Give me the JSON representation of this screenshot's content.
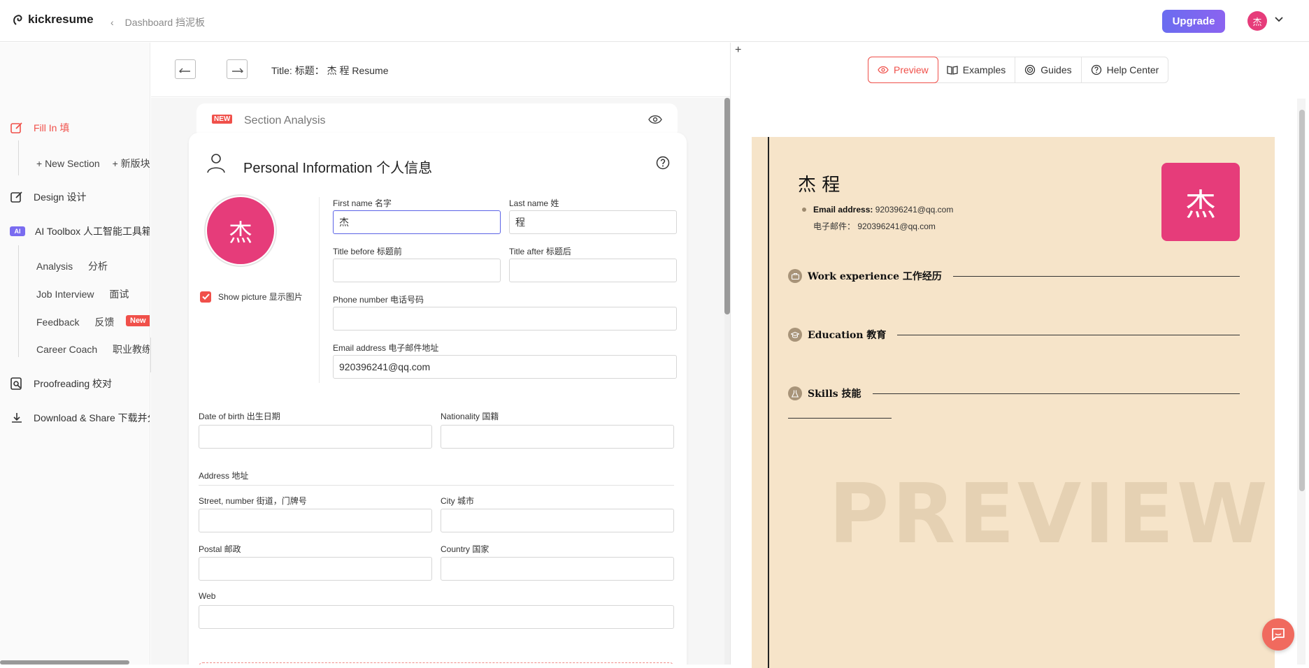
{
  "header": {
    "logo": "kickresume",
    "breadcrumb": "Dashboard 挡泥板",
    "upgrade_label": "Upgrade",
    "avatar_initial": "杰"
  },
  "sidebar": {
    "fill_in": "Fill In 填",
    "new_section": "+ New Section",
    "new_section_cn": "+ 新版块",
    "design": "Design 设计",
    "ai_badge": "AI",
    "ai_toolbox": "AI Toolbox 人工智能工具箱",
    "analysis": "Analysis",
    "analysis_cn": "分析",
    "job_interview": "Job Interview",
    "job_interview_cn": "面试",
    "feedback": "Feedback",
    "feedback_cn": "反馈",
    "feedback_badge": "New",
    "career_coach": "Career Coach",
    "career_coach_cn": "职业教练",
    "proofreading": "Proofreading 校对",
    "download": "Download & Share 下载并分享"
  },
  "toolbar": {
    "title": "Title: 标题：  杰 程 Resume"
  },
  "editor": {
    "analysis_badge": "NEW",
    "analysis_label": "Section Analysis",
    "card_title": "Personal Information 个人信息",
    "photo_initial": "杰",
    "show_picture": "Show picture 显示图片",
    "show_picture_checked": true,
    "fields": {
      "first_name_label": "First name 名字",
      "first_name_value": "杰",
      "last_name_label": "Last name 姓",
      "last_name_value": "程",
      "title_before_label": "Title before 标题前",
      "title_before_value": "",
      "title_after_label": "Title after 标题后",
      "title_after_value": "",
      "phone_label": "Phone number 电话号码",
      "phone_value": "",
      "email_label": "Email address 电子邮件地址",
      "email_value": "920396241@qq.com",
      "dob_label": "Date of birth 出生日期",
      "dob_value": "",
      "nationality_label": "Nationality 国籍",
      "nationality_value": "",
      "address_header": "Address 地址",
      "street_label": "Street, number 街道，门牌号",
      "street_value": "",
      "city_label": "City 城市",
      "city_value": "",
      "postal_label": "Postal 邮政",
      "postal_value": "",
      "country_label": "Country 国家",
      "country_value": "",
      "web_label": "Web",
      "web_value": ""
    }
  },
  "preview_panel": {
    "plus": "+",
    "tabs": [
      "Preview",
      "Examples",
      "Guides",
      "Help Center"
    ],
    "active_tab": "Preview",
    "resume": {
      "name": "杰 程",
      "email_label": "Email address:",
      "email_value": "920396241@qq.com",
      "email_cn": "电子邮件：  920396241@qq.com",
      "photo_initial": "杰",
      "sections": [
        "Work experience 工作经历",
        "Education 教育",
        "Skills 技能"
      ],
      "watermark": "PREVIEW",
      "background": "#f6e4c9"
    }
  },
  "colors": {
    "accent": "#f0504a",
    "avatar": "#e63c7a",
    "upgrade": "#7468f0"
  }
}
